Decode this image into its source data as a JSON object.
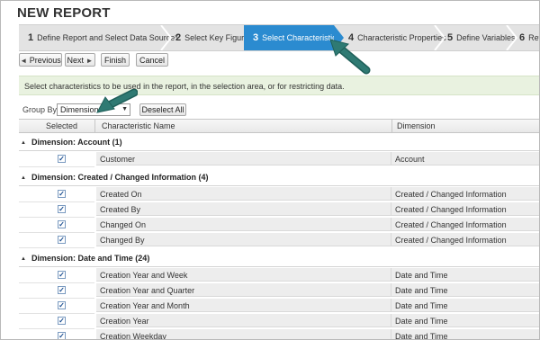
{
  "page": {
    "title": "NEW REPORT"
  },
  "wizard": {
    "steps": [
      {
        "num": "1",
        "label": "Define Report and Select Data Source*"
      },
      {
        "num": "2",
        "label": "Select Key Figures"
      },
      {
        "num": "3",
        "label": "Select Characteristics",
        "active": true
      },
      {
        "num": "4",
        "label": "Characteristic Properties"
      },
      {
        "num": "5",
        "label": "Define Variables"
      },
      {
        "num": "6",
        "label": "Revi"
      }
    ]
  },
  "toolbar": {
    "previous": "Previous",
    "next": "Next",
    "finish": "Finish",
    "cancel": "Cancel"
  },
  "info_text": "Select characteristics to be used in the report, in the selection area, or for restricting data.",
  "group_by": {
    "label": "Group By",
    "value": "Dimension",
    "deselect_all": "Deselect All"
  },
  "table": {
    "headers": {
      "selected": "Selected",
      "name": "Characteristic Name",
      "dimension": "Dimension"
    },
    "groups": [
      {
        "title": "Dimension: Account (1)",
        "rows": [
          {
            "name": "Customer",
            "dimension": "Account",
            "checked": true
          }
        ]
      },
      {
        "title": "Dimension: Created / Changed Information (4)",
        "rows": [
          {
            "name": "Created On",
            "dimension": "Created / Changed Information",
            "checked": true
          },
          {
            "name": "Created By",
            "dimension": "Created / Changed Information",
            "checked": true
          },
          {
            "name": "Changed On",
            "dimension": "Created / Changed Information",
            "checked": true
          },
          {
            "name": "Changed By",
            "dimension": "Created / Changed Information",
            "checked": true
          }
        ]
      },
      {
        "title": "Dimension: Date and Time (24)",
        "rows": [
          {
            "name": "Creation Year and Week",
            "dimension": "Date and Time",
            "checked": true
          },
          {
            "name": "Creation Year and Quarter",
            "dimension": "Date and Time",
            "checked": true
          },
          {
            "name": "Creation Year and Month",
            "dimension": "Date and Time",
            "checked": true
          },
          {
            "name": "Creation Year",
            "dimension": "Date and Time",
            "checked": true
          },
          {
            "name": "Creation Weekday",
            "dimension": "Date and Time",
            "checked": true
          }
        ]
      }
    ]
  },
  "colors": {
    "active_step": "#2b8bd0",
    "info_bg": "#e9f2e0",
    "annotation_arrow": "#2f7a73"
  }
}
